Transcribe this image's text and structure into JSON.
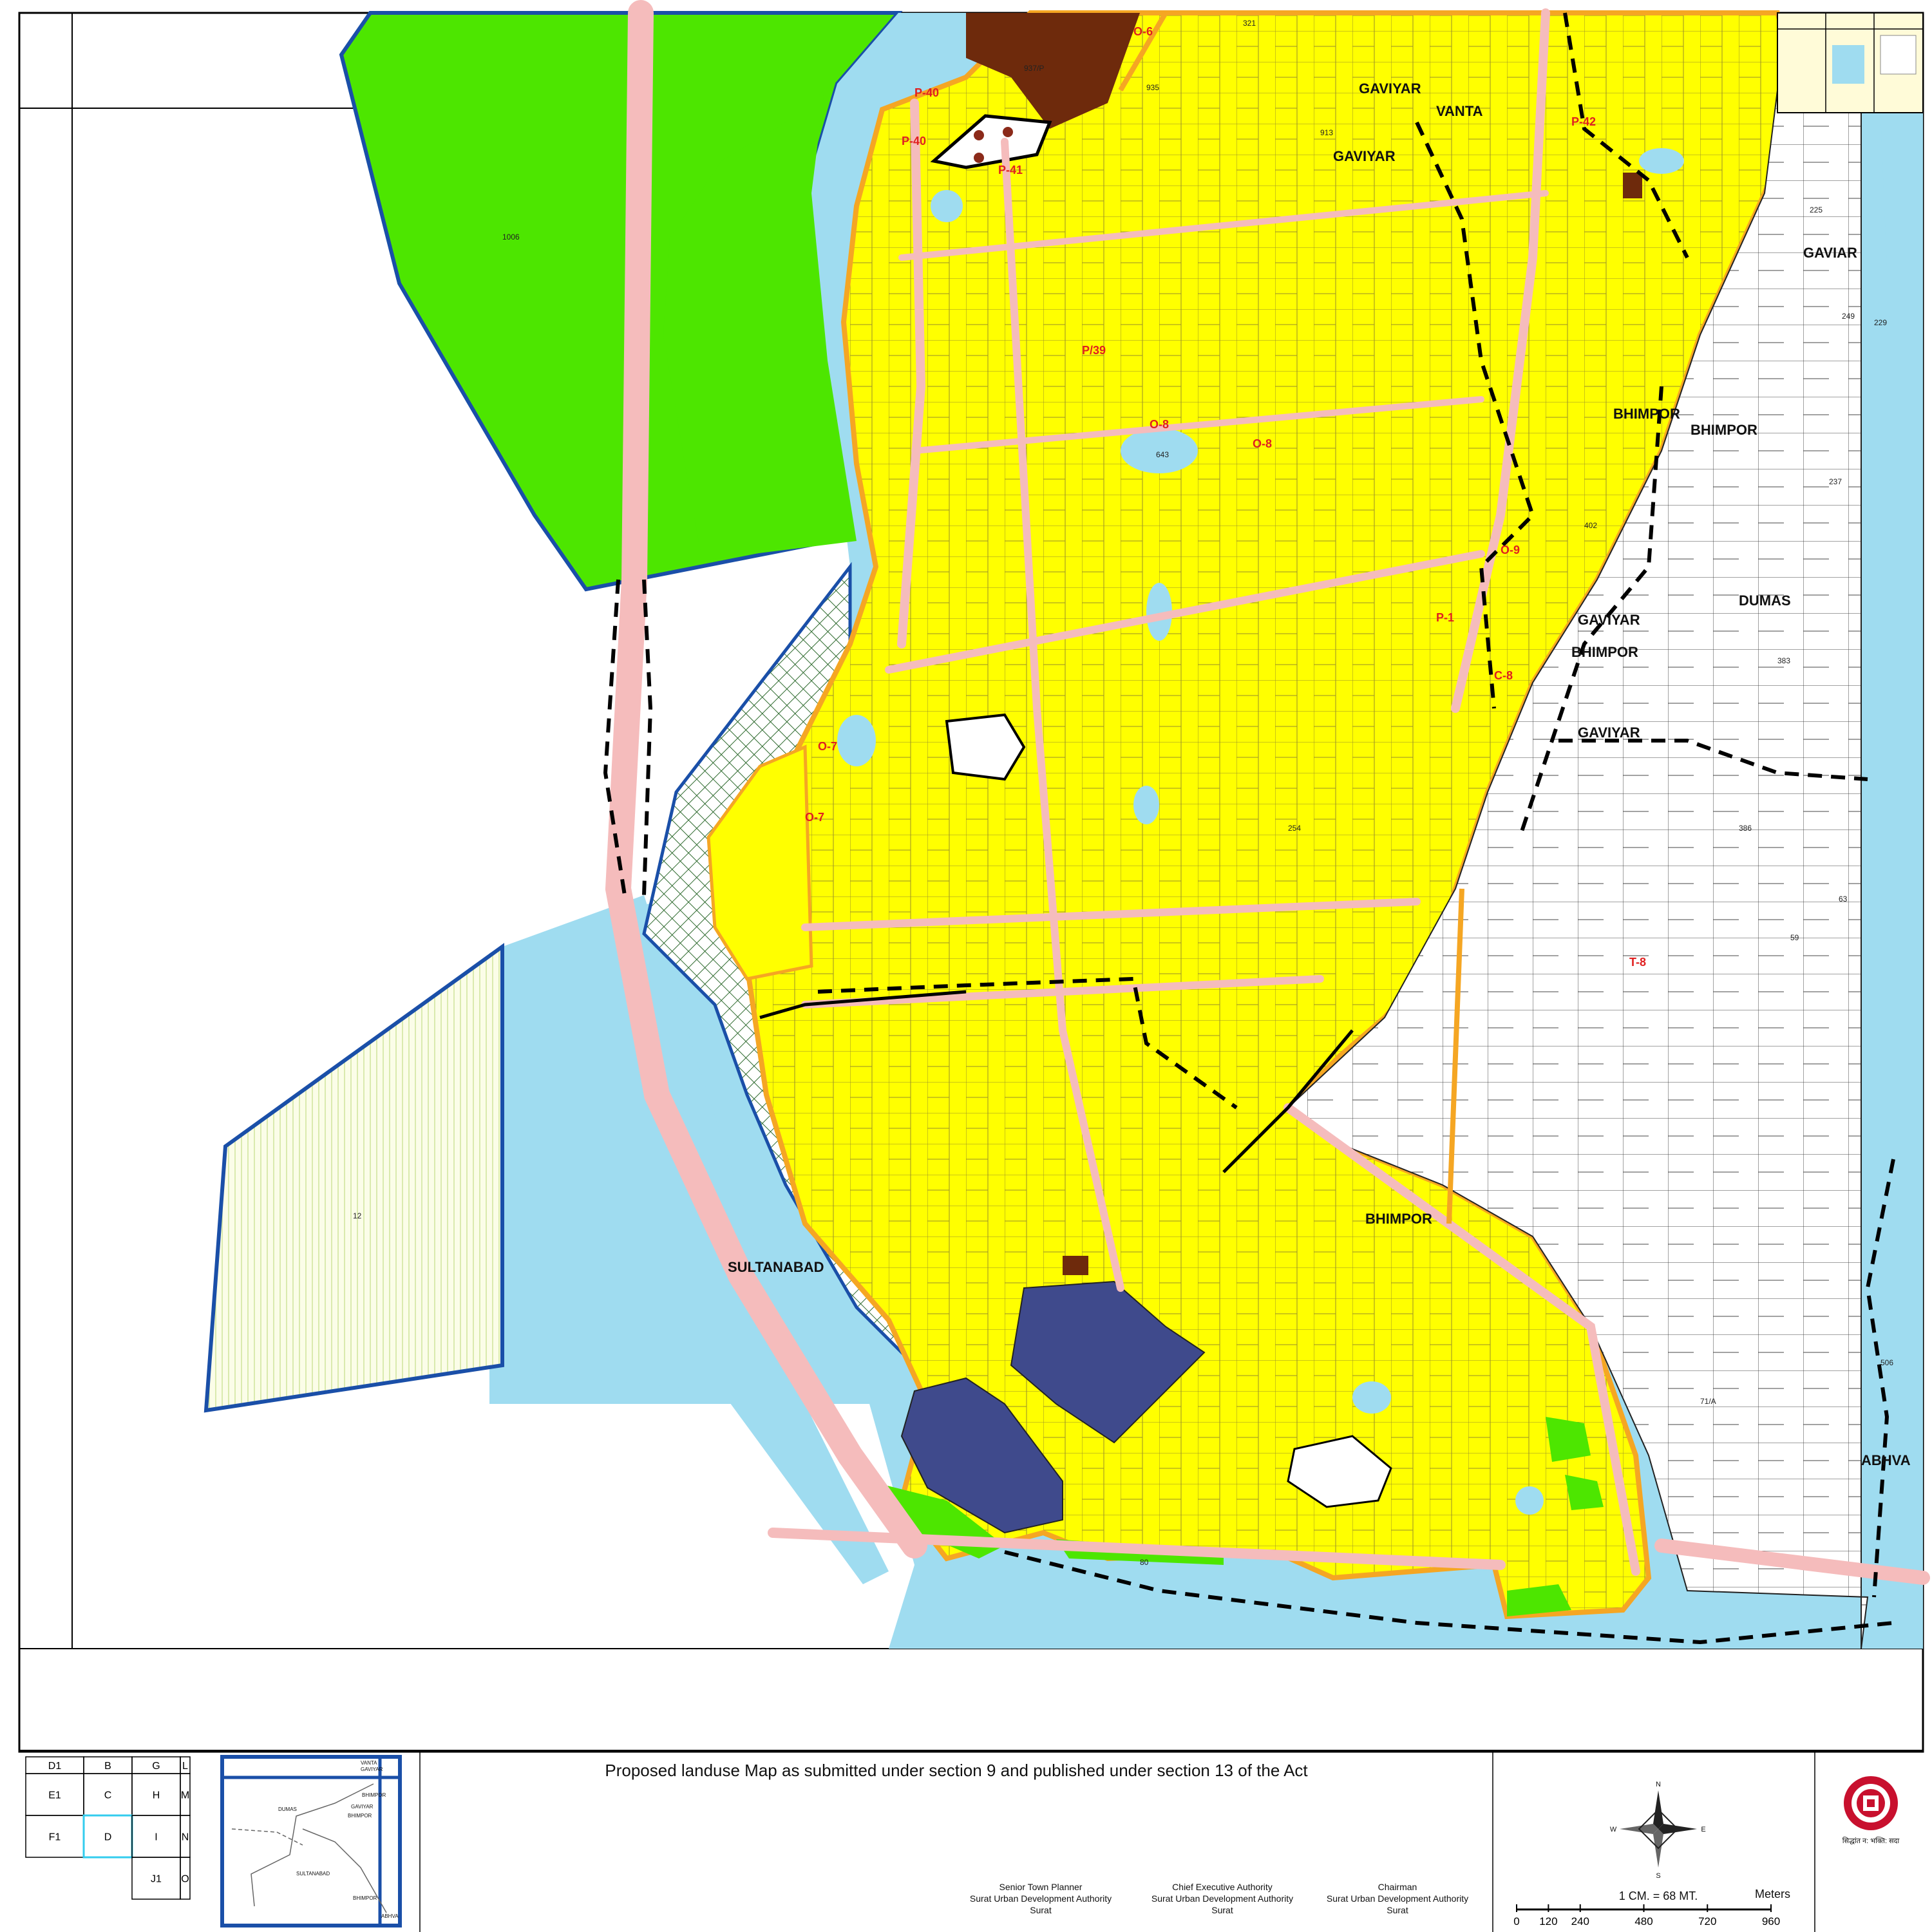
{
  "title": "Proposed landuse Map as submitted under section 9 and published under section 13 of the Act",
  "villages": {
    "gaviyar_1": "GAVIYAR",
    "gaviyar_2": "GAVIYAR",
    "gaviyar_3": "GAVIYAR",
    "gaviyar_4": "GAVIYAR",
    "gaviar": "GAVIAR",
    "vanta": "VANTA",
    "bhimpor_1": "BHIMPOR",
    "bhimpor_2": "BHIMPOR",
    "bhimpor_3": "BHIMPOR",
    "bhimpor_4": "BHIMPOR",
    "dumas": "DUMAS",
    "sultanabad": "SULTANABAD",
    "abhva": "ABHVA"
  },
  "zones": [
    "O-6",
    "P-40",
    "P-40",
    "P-41",
    "P-42",
    "P/39",
    "O-8",
    "O-8",
    "O-9",
    "P-1",
    "C-8",
    "O-7",
    "O-7",
    "T-8"
  ],
  "plots": [
    "1006",
    "12",
    "935",
    "937/P",
    "321",
    "913",
    "643",
    "402",
    "383",
    "225",
    "229",
    "249",
    "254",
    "71/A",
    "506",
    "80",
    "386",
    "237",
    "63",
    "59"
  ],
  "key_grid": {
    "rows": [
      [
        "D1",
        "B",
        "G",
        "L"
      ],
      [
        "E1",
        "C",
        "H",
        "M"
      ],
      [
        "F1",
        "D",
        "I",
        "N"
      ],
      [
        "",
        "",
        "J1",
        "O"
      ]
    ],
    "highlight": "D"
  },
  "inset": {
    "labels": [
      "VANTA",
      "GAVIYAR",
      "BHIMPOR",
      "DUMAS",
      "GAVIYAR",
      "BHIMPOR",
      "SULTANABAD",
      "BHIMPOR",
      "ABHVA"
    ]
  },
  "signatories": [
    {
      "role": "Senior Town Planner",
      "org": "Surat Urban Development Authority",
      "city": "Surat"
    },
    {
      "role": "Chief Executive Authority",
      "org": "Surat Urban Development Authority",
      "city": "Surat"
    },
    {
      "role": "Chairman",
      "org": "Surat Urban Development Authority",
      "city": "Surat"
    }
  ],
  "scale": {
    "text": "1 CM. = 68 MT.",
    "unit": "Meters",
    "ticks": [
      "0",
      "120",
      "240",
      "480",
      "720",
      "960"
    ]
  },
  "compass": {
    "n": "N",
    "s": "S",
    "e": "E",
    "w": "W"
  },
  "logo_motto": "सिद्धांत न: भक्ति: सदा",
  "colors": {
    "residential": "#ffff00",
    "green": "#4de600",
    "water": "#9fdcf0",
    "road": "#f5bcbc",
    "industrial": "#3f4a8c",
    "reserved_brown": "#6e2a0c",
    "boundary_blue": "#1a4fa8",
    "road_orange": "#f5a623",
    "zone_text": "#e02020"
  }
}
